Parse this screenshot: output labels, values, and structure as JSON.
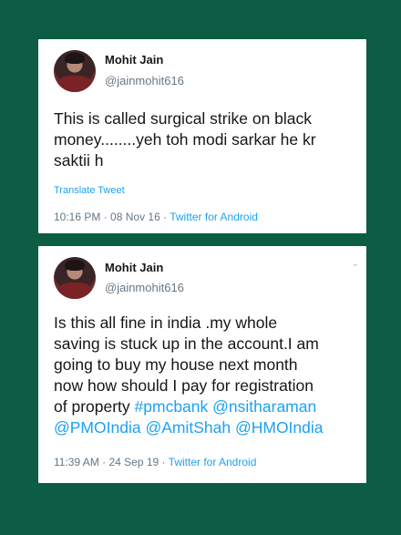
{
  "tweets": [
    {
      "name": "Mohit Jain",
      "handle": "@jainmohit616",
      "text_lines": [
        "This is called surgical strike on black",
        "money........yeh toh modi sarkar he kr",
        "saktii h"
      ],
      "translate": "Translate Tweet",
      "time": "10:16 PM",
      "sep": " · ",
      "date": "08 Nov 16",
      "source": "Twitter for Android"
    },
    {
      "name": "Mohit Jain",
      "handle": "@jainmohit616",
      "chevron": "⌄",
      "text_lines": [
        "Is this all fine in india .my whole",
        "saving is stuck up in the account.I am",
        "going to buy my house next month",
        "now how should I pay for registration",
        "of property "
      ],
      "hashtag": "#pmcbank",
      "mentions_line1": "@nsitharaman",
      "mentions_line2": [
        "@PMOIndia",
        "@AmitShah",
        "@HMOIndia"
      ],
      "time": "11:39 AM",
      "sep": " · ",
      "date": "24 Sep 19",
      "source": "Twitter for Android"
    }
  ]
}
